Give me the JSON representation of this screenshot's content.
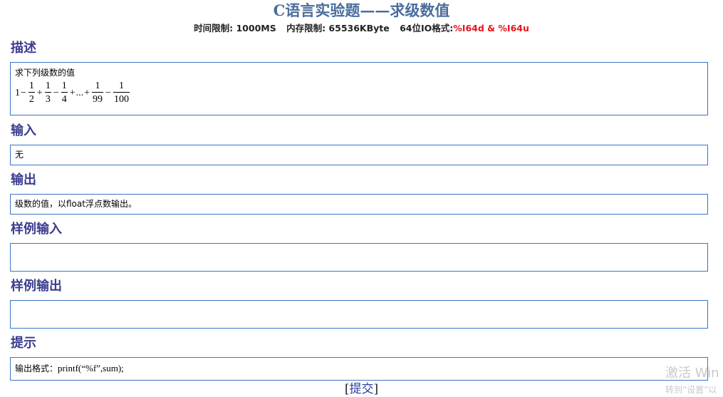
{
  "problem": {
    "title": "C语言实验题——求级数值",
    "limits": {
      "time": "时间限制: 1000MS",
      "memory": "内存限制: 65536KByte",
      "io_label": "64位IO格式:",
      "io_format": "%I64d & %I64u"
    }
  },
  "sections": {
    "description": {
      "heading": "描述",
      "text": "求下列级数的值",
      "formula": {
        "lead": "1",
        "minus": "−",
        "plus": "+",
        "ellipsis": "...",
        "one": "1",
        "d2": "2",
        "d3": "3",
        "d4": "4",
        "d99": "99",
        "d100": "100"
      }
    },
    "input": {
      "heading": "输入",
      "text": "无"
    },
    "output": {
      "heading": "输出",
      "text": "级数的值，以float浮点数输出。"
    },
    "sample_input": {
      "heading": "样例输入",
      "text": ""
    },
    "sample_output": {
      "heading": "样例输出",
      "text": ""
    },
    "hint": {
      "heading": "提示",
      "label": "输出格式：",
      "code": "printf(“%f”,sum);"
    }
  },
  "submit": {
    "open": "[",
    "label": "提交",
    "close": "]"
  },
  "watermark": {
    "line1": "激活 Win",
    "line2": "转到“设置”以"
  }
}
